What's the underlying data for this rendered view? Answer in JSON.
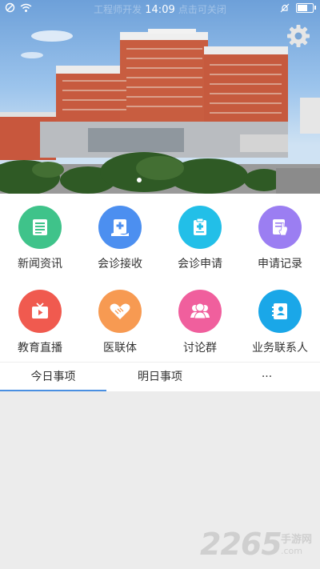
{
  "statusbar": {
    "ghost_left": "工程师开发",
    "time": "14:09",
    "ghost_right": "点击可关闭"
  },
  "banner": {
    "slide_count": 1,
    "active_slide": 1
  },
  "grid": [
    {
      "label": "新闻资讯",
      "icon": "news-icon",
      "color": "#3fc38a"
    },
    {
      "label": "会诊接收",
      "icon": "consult-receive-icon",
      "color": "#4c8ff0"
    },
    {
      "label": "会诊申请",
      "icon": "consult-apply-icon",
      "color": "#22bfe8"
    },
    {
      "label": "申请记录",
      "icon": "apply-record-icon",
      "color": "#9b7ef2"
    },
    {
      "label": "教育直播",
      "icon": "tv-live-icon",
      "color": "#f05a4f"
    },
    {
      "label": "医联体",
      "icon": "handshake-icon",
      "color": "#f79a52"
    },
    {
      "label": "讨论群",
      "icon": "group-icon",
      "color": "#f05f9d"
    },
    {
      "label": "业务联系人",
      "icon": "contact-book-icon",
      "color": "#1aa7e8"
    }
  ],
  "tabs": {
    "items": [
      "今日事项",
      "明日事项",
      "···"
    ],
    "active": 0,
    "accent": "#4a90e2"
  },
  "watermark": {
    "number": "2265",
    "cn": "手游网",
    "domain": ".com"
  }
}
